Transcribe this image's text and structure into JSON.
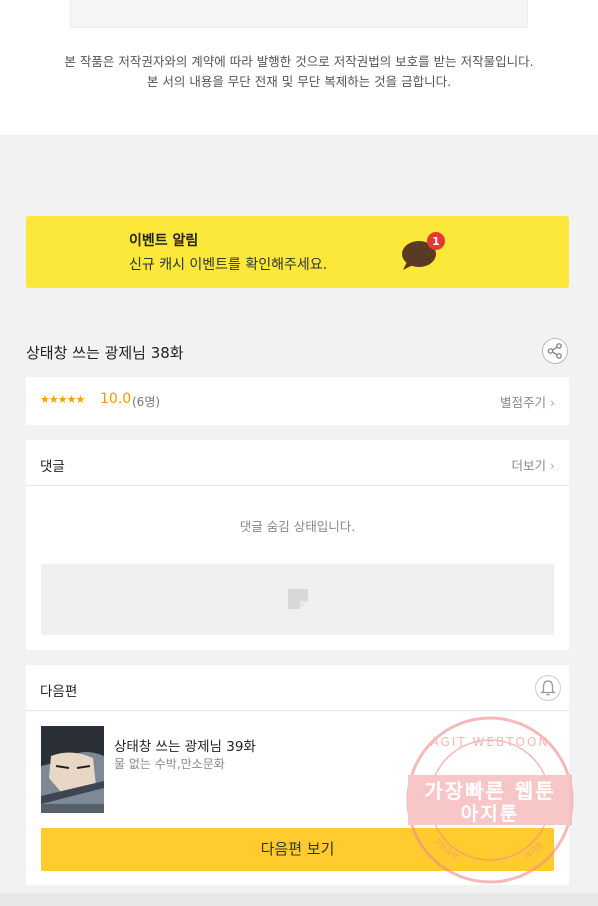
{
  "top": {
    "box_text": "",
    "copyright_line1": "본 작품은 저작권자와의 계약에 따라 발행한 것으로 저작권법의 보호를 받는 저작물입니다.",
    "copyright_line2": "본 서의 내용을 무단 전재 및 무단 복제하는 것을 금합니다."
  },
  "event": {
    "title": "이벤트 알림",
    "subtitle": "신규 캐시 이벤트를 확인해주세요.",
    "badge": "1",
    "icon": "chat-bubble-icon",
    "bg_color": "#fce83a"
  },
  "episode": {
    "title": "상태창 쓰는 광제님 38화",
    "share_icon": "share-icon"
  },
  "rating": {
    "stars": "★★★★★",
    "score": "10.0",
    "count": "(6명)",
    "rate_link": "별점주기"
  },
  "comments": {
    "title": "댓글",
    "more": "더보기",
    "hidden_msg": "댓글 숨김 상태입니다."
  },
  "next": {
    "title": "다음편",
    "bell_icon": "bell-icon",
    "ep_title": "상태창 쓰는 광제님 39화",
    "ep_sub": "물 없는 수박,만소문화",
    "button": "다음편 보기",
    "button_color": "#ffcb2e"
  },
  "watermark": {
    "top_text": "AGIT WEBTOON",
    "line1": "가장빠른 웹툰",
    "line2": "아지툰",
    "bottom_left": "그림검색",
    "bottom_right": "아지툰"
  }
}
